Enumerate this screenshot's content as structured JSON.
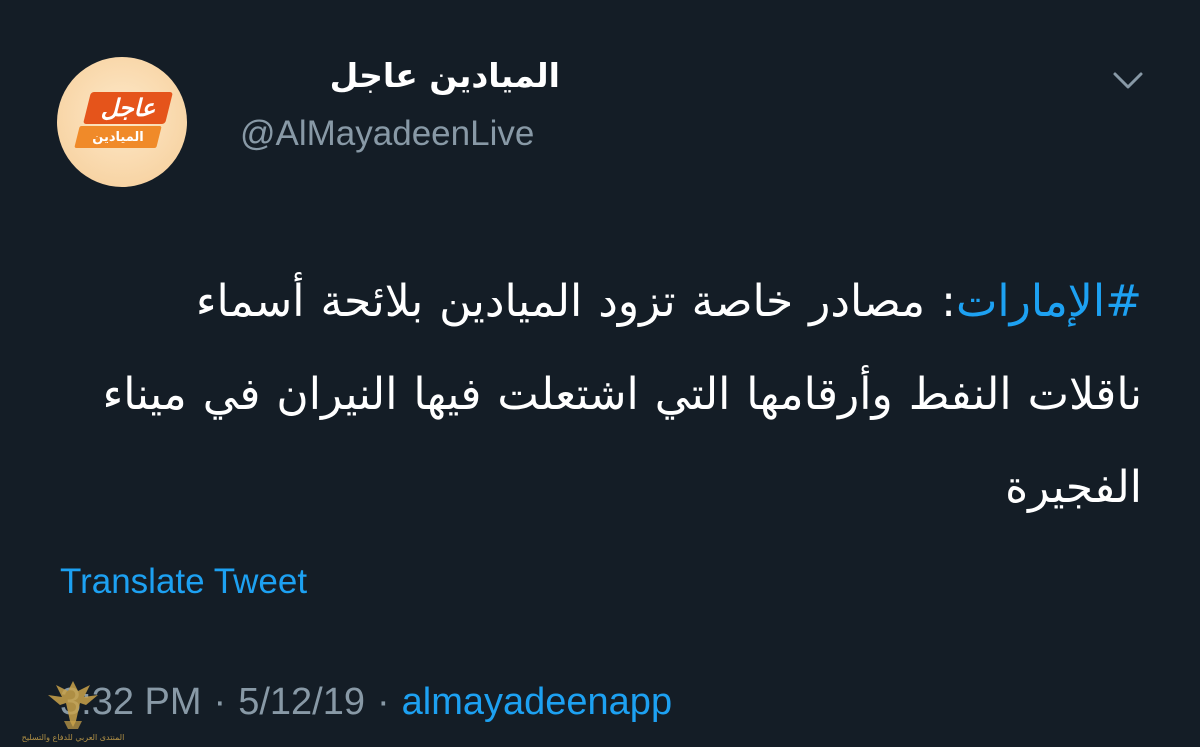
{
  "account": {
    "display_name": "الميادين عاجل",
    "handle": "@AlMayadeenLive",
    "avatar_logo": {
      "top_text": "عاجل",
      "bottom_text": "الميادين"
    }
  },
  "tweet": {
    "hashtag": "#الإمارات",
    "text": ": مصادر خاصة تزود الميادين بلائحة أسماء ناقلات النفط وأرقامها التي اشتعلت فيها النيران في ميناء الفجيرة"
  },
  "translate_label": "Translate Tweet",
  "meta": {
    "time": "3:32 PM",
    "separator": "·",
    "date": "5/12/19",
    "source": "almayadeenapp"
  },
  "watermark": {
    "text": "المنتدى العربي للدفاع والتسليح"
  },
  "icons": {
    "menu": "chevron-down-icon",
    "watermark": "eagle-emblem-icon"
  },
  "colors": {
    "background": "#141d26",
    "link": "#1da1f2",
    "secondary_text": "#8899a6",
    "logo_orange": "#e5541b"
  }
}
